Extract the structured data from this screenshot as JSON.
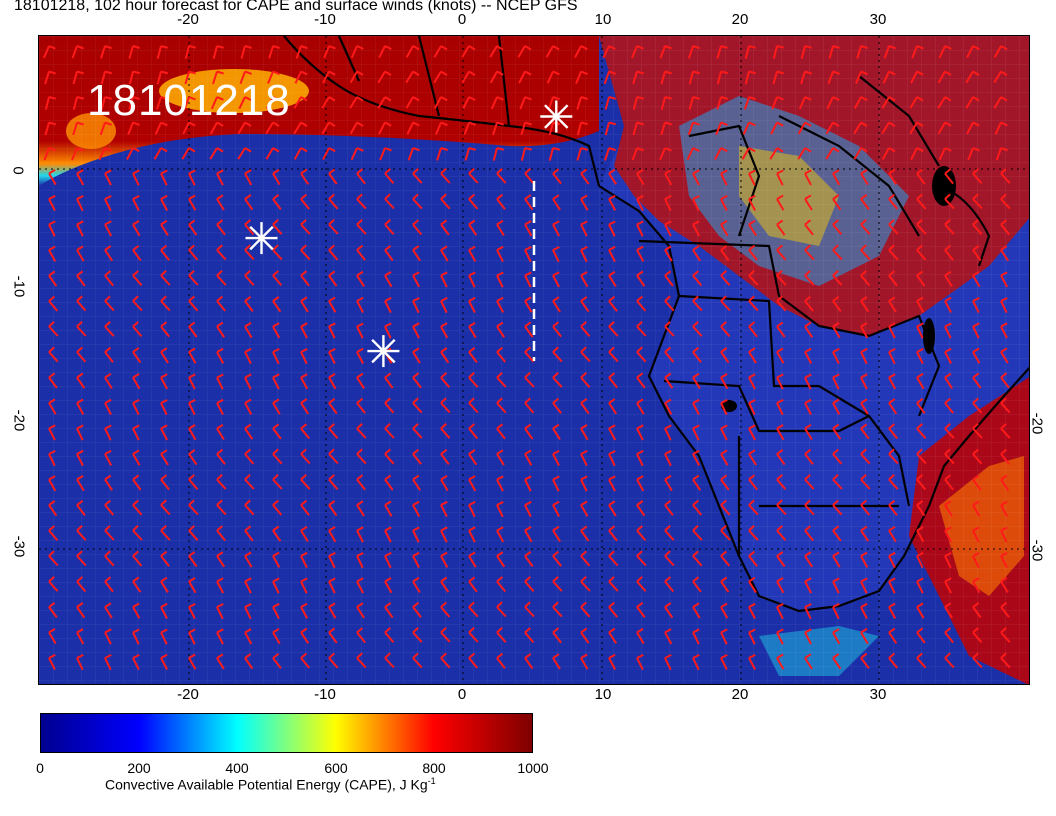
{
  "title": "18101218, 102 hour forecast for CAPE and surface winds (knots) -- NCEP GFS",
  "stamp": "18101218",
  "axes": {
    "lon_ticks": [
      "-20",
      "-10",
      "0",
      "10",
      "20",
      "30"
    ],
    "lat_ticks": [
      "0",
      "-10",
      "-20",
      "-30"
    ]
  },
  "colorbar": {
    "ticks": [
      "0",
      "200",
      "400",
      "600",
      "800",
      "1000"
    ],
    "label_main": "Convective Available Potential Energy (CAPE), J Kg",
    "label_exp": "-1",
    "range": [
      0,
      1000
    ],
    "colors": [
      "#00008f",
      "#0000ff",
      "#00ffff",
      "#ffff00",
      "#ff0000",
      "#7f0000"
    ]
  },
  "map": {
    "extent": {
      "lon": [
        -30,
        40
      ],
      "lat": [
        -40,
        6
      ]
    },
    "ocean_color": "#1a2fa8",
    "land_color": "#2a3fc0",
    "barb_color": "#ff1a1a",
    "markers": [
      {
        "name": "star-1",
        "lon": 6.5,
        "lat": 0.3
      },
      {
        "name": "star-2",
        "lon": -14.3,
        "lat": -8.3
      },
      {
        "name": "star-3",
        "lon": -5.7,
        "lat": -16.3
      }
    ]
  }
}
